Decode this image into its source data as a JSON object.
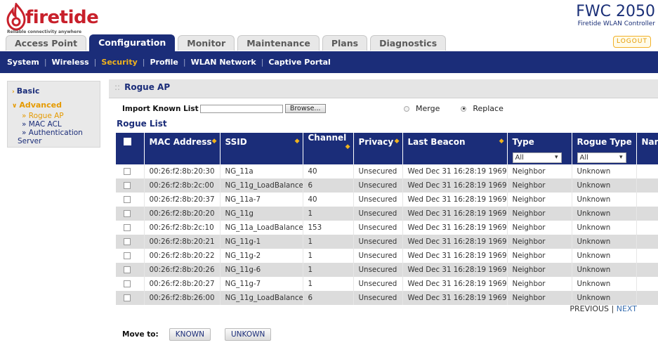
{
  "brand": {
    "logo_text": "firetide",
    "tagline": "Reliable connectivity anywhere",
    "product_name": "FWC 2050",
    "product_sub": "Firetide WLAN Controller",
    "logout_label": "LOGOUT"
  },
  "tabs": [
    {
      "label": "Access Point",
      "active": false
    },
    {
      "label": "Configuration",
      "active": true
    },
    {
      "label": "Monitor",
      "active": false
    },
    {
      "label": "Maintenance",
      "active": false
    },
    {
      "label": "Plans",
      "active": false
    },
    {
      "label": "Diagnostics",
      "active": false
    }
  ],
  "subnav": [
    {
      "label": "System",
      "active": false
    },
    {
      "label": "Wireless",
      "active": false
    },
    {
      "label": "Security",
      "active": true
    },
    {
      "label": "Profile",
      "active": false
    },
    {
      "label": "WLAN Network",
      "active": false
    },
    {
      "label": "Captive Portal",
      "active": false
    }
  ],
  "sidebar": {
    "basic": "Basic",
    "advanced": "Advanced",
    "items": [
      {
        "label": "» Rogue AP",
        "active": true
      },
      {
        "label": "» MAC ACL",
        "active": false
      },
      {
        "label": "» Authentication",
        "active": false
      },
      {
        "label": "Server",
        "active": false
      }
    ]
  },
  "panel": {
    "title": "Rogue AP",
    "import_label": "Import Known List",
    "browse_label": "Browse...",
    "merge_label": "Merge",
    "replace_label": "Replace",
    "list_title": "Rogue List"
  },
  "table": {
    "headers": [
      "MAC Address",
      "SSID",
      "Channel",
      "Privacy",
      "Last Beacon",
      "Type",
      "Rogue Type",
      "Nar"
    ],
    "filters": {
      "type": "All",
      "rogue_type": "All"
    },
    "rows": [
      [
        "00:26:f2:8b:20:30",
        "NG_11a",
        "40",
        "Unsecured",
        "Wed Dec 31 16:28:19 1969",
        "Neighbor",
        "Unknown"
      ],
      [
        "00:26:f2:8b:2c:00",
        "NG_11g_LoadBalance",
        "6",
        "Unsecured",
        "Wed Dec 31 16:28:19 1969",
        "Neighbor",
        "Unknown"
      ],
      [
        "00:26:f2:8b:20:37",
        "NG_11a-7",
        "40",
        "Unsecured",
        "Wed Dec 31 16:28:19 1969",
        "Neighbor",
        "Unknown"
      ],
      [
        "00:26:f2:8b:20:20",
        "NG_11g",
        "1",
        "Unsecured",
        "Wed Dec 31 16:28:19 1969",
        "Neighbor",
        "Unknown"
      ],
      [
        "00:26:f2:8b:2c:10",
        "NG_11a_LoadBalance",
        "153",
        "Unsecured",
        "Wed Dec 31 16:28:19 1969",
        "Neighbor",
        "Unknown"
      ],
      [
        "00:26:f2:8b:20:21",
        "NG_11g-1",
        "1",
        "Unsecured",
        "Wed Dec 31 16:28:19 1969",
        "Neighbor",
        "Unknown"
      ],
      [
        "00:26:f2:8b:20:22",
        "NG_11g-2",
        "1",
        "Unsecured",
        "Wed Dec 31 16:28:19 1969",
        "Neighbor",
        "Unknown"
      ],
      [
        "00:26:f2:8b:20:26",
        "NG_11g-6",
        "1",
        "Unsecured",
        "Wed Dec 31 16:28:19 1969",
        "Neighbor",
        "Unknown"
      ],
      [
        "00:26:f2:8b:20:27",
        "NG_11g-7",
        "1",
        "Unsecured",
        "Wed Dec 31 16:28:19 1969",
        "Neighbor",
        "Unknown"
      ],
      [
        "00:26:f2:8b:26:00",
        "NG_11g_LoadBalance",
        "6",
        "Unsecured",
        "Wed Dec 31 16:28:19 1969",
        "Neighbor",
        "Unknown"
      ]
    ]
  },
  "pager": {
    "previous": "PREVIOUS",
    "separator": "|",
    "next": "NEXT"
  },
  "moveto": {
    "label": "Move to:",
    "known": "KNOWN",
    "unknown": "UNKOWN"
  },
  "colors": {
    "nav_blue": "#1b2d79",
    "accent_orange": "#f1b31c",
    "brand_red": "#c8202b"
  }
}
